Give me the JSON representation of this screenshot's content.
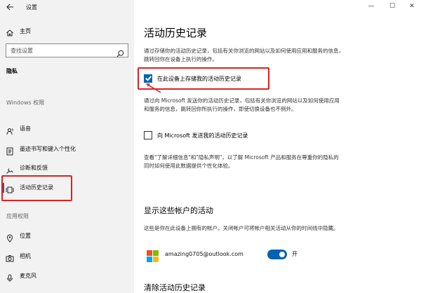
{
  "window": {
    "app_title": "设置",
    "back_icon": "back-arrow-icon",
    "controls": {
      "minimize": "—",
      "maximize": "☐",
      "close": "✕"
    }
  },
  "sidebar": {
    "home_label": "主页",
    "search_placeholder": "查找设置",
    "privacy_heading": "隐私",
    "windows_permissions_heading": "Windows 权限",
    "items": [
      {
        "label": "语音",
        "icon": "speech-icon"
      },
      {
        "label": "墨迹书写和键入个性化",
        "icon": "pen-icon"
      },
      {
        "label": "诊断和反馈",
        "icon": "diagnostics-icon"
      },
      {
        "label": "活动历史记录",
        "icon": "activity-icon",
        "selected": true
      }
    ],
    "app_permissions_heading": "应用权限",
    "app_items": [
      {
        "label": "位置",
        "icon": "location-icon"
      },
      {
        "label": "相机",
        "icon": "camera-icon"
      },
      {
        "label": "麦克风",
        "icon": "microphone-icon"
      }
    ]
  },
  "main": {
    "title": "活动历史记录",
    "description1": "通过存储你的活动历史记录，包括有关你浏览的网站以及如何使用应用和服务的信息，跳转回你在设备上执行的操作。",
    "store_checkbox": {
      "label": "在此设备上存储我的活动历史记录",
      "checked": true
    },
    "description2": "通过向 Microsoft 发送你的活动历史记录，包括有关你浏览的网站以及如何使用应用和服务的信息，跳转回你所执行的操作，即使切换设备也不例外。",
    "send_checkbox": {
      "label": "向 Microsoft 发送我的活动历史记录",
      "checked": false
    },
    "description3": "查看\"了解详细信息\"和\"隐私声明\"，以了解 Microsoft 产品和服务在尊重你的隐私的同时如何使用此数据提供个性化体验。",
    "accounts_heading": "显示这些帐户的活动",
    "accounts_description": "这些是你在此设备上拥有的帐户。关闭帐户可将帐户相关活动从你的时间线中隐藏。",
    "account": {
      "email": "amazing0705@outlook.com",
      "toggle_label": "开",
      "toggle_on": true
    },
    "clear_heading": "清除活动历史记录"
  },
  "colors": {
    "accent": "#0063b1",
    "highlight": "#e02020",
    "sidebar_bg": "#f2f2f2"
  }
}
